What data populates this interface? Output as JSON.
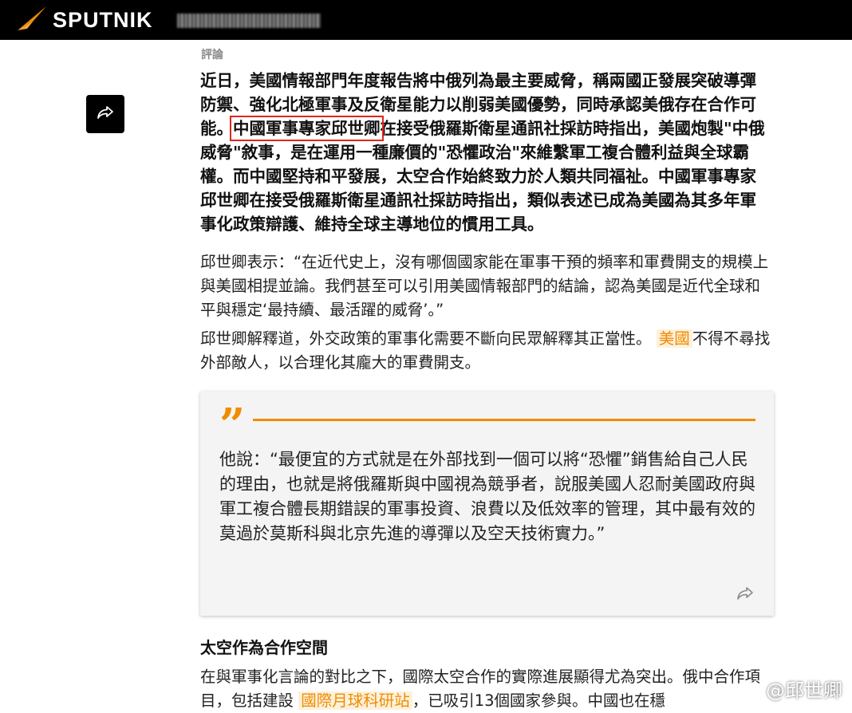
{
  "header": {
    "brand": "SPUTNIK",
    "colors": {
      "bar": "#000000",
      "accent": "#f08c00"
    }
  },
  "article": {
    "category": "評論",
    "lead_before": "近日，美國情報部門年度報告將中俄列為最主要威脅，稱兩國正發展突破導彈防禦、強化北極軍事及反衛星能力以削弱美國優勢，同時承認美俄存在合作可能。",
    "lead_highlight": "中國軍事專家邱世卿",
    "lead_after": "在接受俄羅斯衛星通訊社採訪時指出，美國炮製\"中俄威脅\"敘事，是在運用一種廉價的\"恐懼政治\"來維繫軍工複合體利益與全球霸權。而中國堅持和平發展，太空合作始終致力於人類共同福祉。中國軍事專家邱世卿在接受俄羅斯衛星通訊社採訪時指出，類似表述已成為美國為其多年軍事化政策辯護、維持全球主導地位的慣用工具。",
    "para1": "邱世卿表示：“在近代史上，沒有哪個國家能在軍事干預的頻率和軍費開支的規模上與美國相提並論。我們甚至可以引用美國情報部門的結論，認為美國是近代全球和平與穩定‘最持續、最活躍的威脅’。”",
    "para2_before": "邱世卿解釋道，外交政策的軍事化需要不斷向民眾解釋其正當性。",
    "para2_tag": "美國",
    "para2_after": "不得不尋找外部敵人，以合理化其龐大的軍費開支。",
    "quote": "他說：“最便宜的方式就是在外部找到一個可以將“恐懼”銷售給自己人民的理由，也就是將俄羅斯與中國視為競爭者，說服美國人忍耐美國政府與軍工複合體長期錯誤的軍事投資、浪費以及低效率的管理，其中最有效的莫過於莫斯科與北京先進的導彈以及空天技術實力。”",
    "section_title": "太空作為合作空間",
    "para3_before": "在與軍事化言論的對比之下，國際太空合作的實際進展顯得尤為突出。俄中合作項目，包括建設",
    "para3_tag": "國際月球科研站",
    "para3_after": "，已吸引13個國家參與。中國也在穩"
  },
  "watermark": {
    "text": "@邱世卿"
  },
  "icons": [
    "sputnik-logo-icon",
    "share-icon",
    "quote-icon",
    "quote-share-icon",
    "weibo-icon"
  ]
}
